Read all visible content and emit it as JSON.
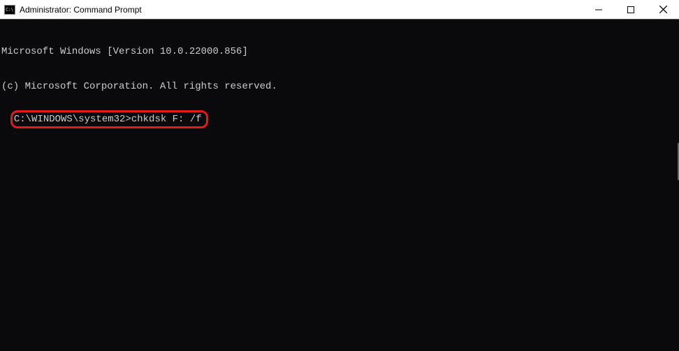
{
  "window": {
    "title": "Administrator: Command Prompt"
  },
  "terminal": {
    "line1": "Microsoft Windows [Version 10.0.22000.856]",
    "line2": "(c) Microsoft Corporation. All rights reserved.",
    "prompt": "C:\\WINDOWS\\system32>",
    "command": "chkdsk F: /f"
  }
}
